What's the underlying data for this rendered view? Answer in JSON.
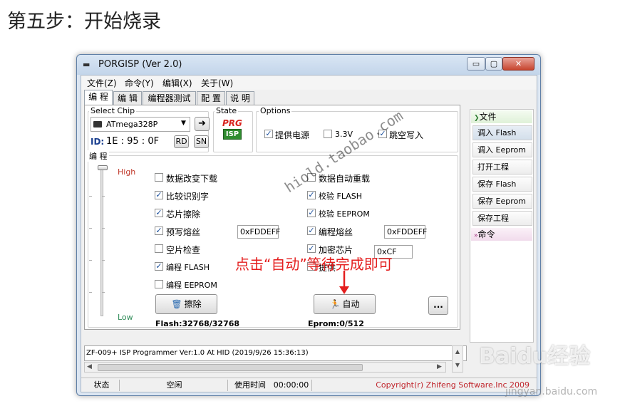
{
  "heading": "第五步：开始烧录",
  "window": {
    "title": "PORGISP (Ver 2.0)",
    "controls": {
      "minimize": "▭",
      "maximize": "▢",
      "close": "✕"
    }
  },
  "menu": [
    "文件(Z)",
    "命令(Y)",
    "编辑(X)",
    "关于(W)"
  ],
  "tabs": [
    "编 程",
    "编 辑",
    "编程器测试",
    "配 置",
    "说 明"
  ],
  "chip": {
    "label": "Select Chip",
    "value": "ATmega328P",
    "id_label": "ID:",
    "id_value": "1E : 95 : 0F",
    "rd_button": "RD",
    "sn_button": "SN"
  },
  "state": {
    "label": "State",
    "logo_top": "PRG",
    "logo_bottom": "ISP"
  },
  "options": {
    "label": "Options",
    "items": [
      {
        "label": "提供电源",
        "checked": true
      },
      {
        "label": "3.3V",
        "checked": false
      },
      {
        "label": "跳空写入",
        "checked": true
      }
    ]
  },
  "program": {
    "label": "编 程",
    "slider_high": "High",
    "slider_low": "Low",
    "left_checks": [
      {
        "label": "数据改变下载",
        "checked": false
      },
      {
        "label": "比较识别字",
        "checked": true
      },
      {
        "label": "芯片擦除",
        "checked": true
      },
      {
        "label": "预写熔丝",
        "checked": true
      },
      {
        "label": "空片检查",
        "checked": false
      },
      {
        "label": "编程 FLASH",
        "checked": true
      },
      {
        "label": "编程 EEPROM",
        "checked": false
      }
    ],
    "right_checks": [
      {
        "label": "数据自动重载",
        "checked": false
      },
      {
        "label": "校验 FLASH",
        "checked": true
      },
      {
        "label": "校验 EEPROM",
        "checked": true
      },
      {
        "label": "编程熔丝",
        "checked": true
      },
      {
        "label": "加密芯片",
        "checked": true
      },
      {
        "label": "提供",
        "checked": false
      }
    ],
    "prewrite_fuse_value": "0xFDDEFF",
    "program_fuse_value": "0xFDDEFF",
    "lock_value": "0xCF",
    "erase_button": "擦除",
    "auto_button": "自动",
    "more_button": "...",
    "flash_info": "Flash:32768/32768",
    "eeprom_info": "Eprom:0/512"
  },
  "log": "ZF-009+ ISP Programmer Ver:1.0 At HID (2019/9/26 15:36:13)",
  "statusbar": {
    "state_label": "状态",
    "state_value": "空闲",
    "time_label": "使用时间",
    "time_value": "00:00:00",
    "copyright": "Copyright(r) Zhifeng Software.Inc 2009"
  },
  "sidebar": {
    "file_header": "文件",
    "items": [
      "调入 Flash",
      "调入 Eeprom",
      "打开工程",
      "保存 Flash",
      "保存 Eeprom",
      "保存工程"
    ],
    "command_header": "命令"
  },
  "annotation": "点击“自动”等待完成即可",
  "watermark_taobao": "hiold.taobao.com",
  "watermark_baidu": "Baidu经验",
  "watermark_baidu_sub": "jingyan.baidu.com",
  "colors": {
    "annotation": "#e41e1e",
    "copyright": "#c0262d",
    "id_label": "#1a3f8f"
  }
}
